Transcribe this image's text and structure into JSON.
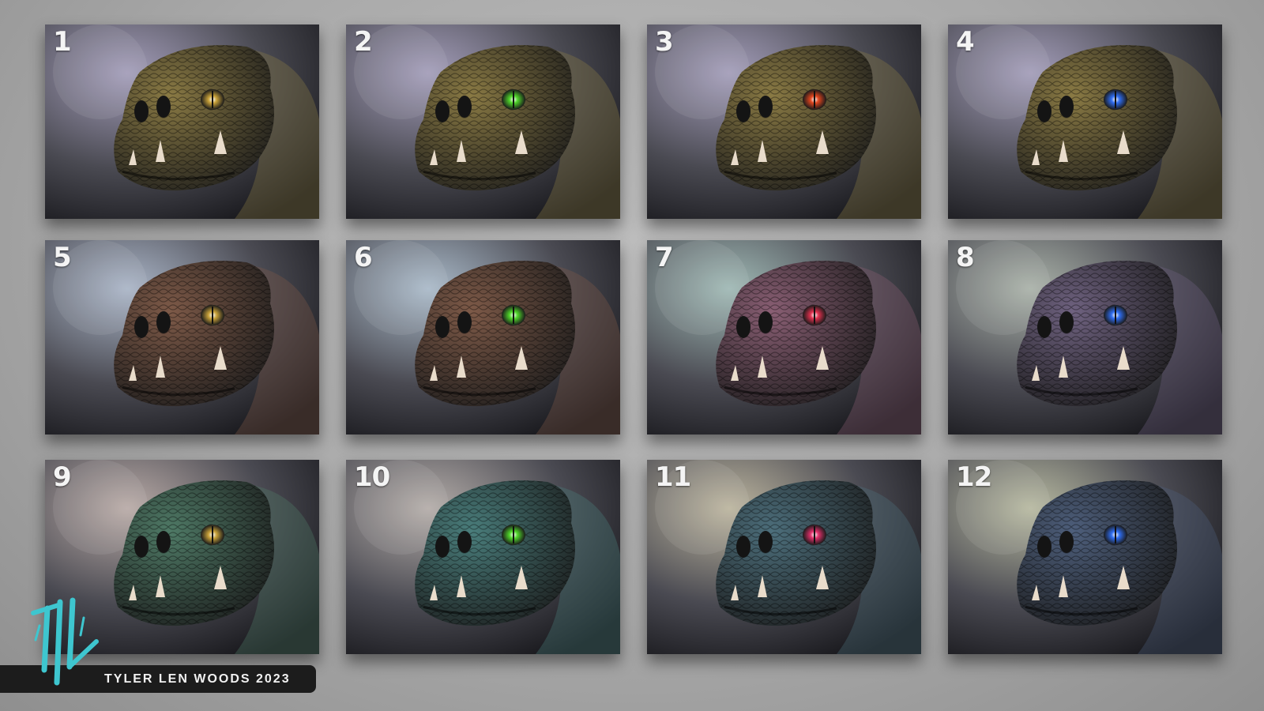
{
  "credit": {
    "text": "TYLER LEN WOODS  2023",
    "logo_icon": "tlw-monogram-logo",
    "logo_color": "#3ec6cf"
  },
  "tiles": [
    {
      "number": "1",
      "bg_color": "#a29cb8",
      "skin_color": "#8a7a44",
      "eye_color": "#c9a23a"
    },
    {
      "number": "2",
      "bg_color": "#a29cb8",
      "skin_color": "#8a7a44",
      "eye_color": "#4fd42a"
    },
    {
      "number": "3",
      "bg_color": "#a29cb8",
      "skin_color": "#8a7a44",
      "eye_color": "#e0451e"
    },
    {
      "number": "4",
      "bg_color": "#a29cb8",
      "skin_color": "#8a7a44",
      "eye_color": "#2f6df0"
    },
    {
      "number": "5",
      "bg_color": "#a9b4c6",
      "skin_color": "#7e5a48",
      "eye_color": "#c9a23a"
    },
    {
      "number": "6",
      "bg_color": "#a9b9c8",
      "skin_color": "#7e5a48",
      "eye_color": "#4fd42a"
    },
    {
      "number": "7",
      "bg_color": "#9fb8b4",
      "skin_color": "#8a5f74",
      "eye_color": "#e0304e"
    },
    {
      "number": "8",
      "bg_color": "#a9b1a8",
      "skin_color": "#6f6280",
      "eye_color": "#2f6df0"
    },
    {
      "number": "9",
      "bg_color": "#b8aaa6",
      "skin_color": "#4f7a66",
      "eye_color": "#c9a23a"
    },
    {
      "number": "10",
      "bg_color": "#b3aca8",
      "skin_color": "#4a7e7c",
      "eye_color": "#4fd42a"
    },
    {
      "number": "11",
      "bg_color": "#bbb49e",
      "skin_color": "#4d6f7c",
      "eye_color": "#e0306a"
    },
    {
      "number": "12",
      "bg_color": "#b6b8a0",
      "skin_color": "#4e5f7c",
      "eye_color": "#2f6df0"
    }
  ]
}
